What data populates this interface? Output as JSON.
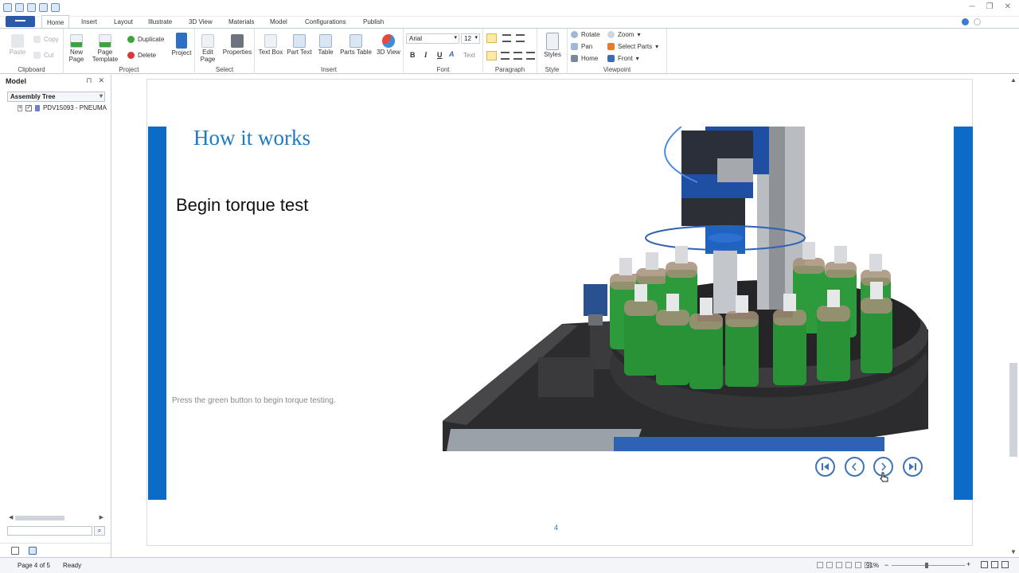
{
  "ribbon": {
    "tabs": [
      "Home",
      "Insert",
      "Layout",
      "Illustrate",
      "3D View",
      "Materials",
      "Model",
      "Configurations",
      "Publish"
    ],
    "clipboard": {
      "paste": "Paste",
      "copy": "Copy",
      "cut": "Cut",
      "label": "Clipboard"
    },
    "project": {
      "new_page_1": "New",
      "new_page_2": "Page",
      "page_template_1": "Page",
      "page_template_2": "Template",
      "duplicate": "Duplicate",
      "delete": "Delete",
      "project": "Project",
      "label": "Project"
    },
    "select": {
      "edit_page_1": "Edit",
      "edit_page_2": "Page",
      "properties": "Properties",
      "label": "Select"
    },
    "insert": {
      "text_box": "Text Box",
      "part_text": "Part Text",
      "table": "Table",
      "parts_table": "Parts Table",
      "view_3d": "3D View",
      "label": "Insert"
    },
    "font": {
      "name": "Arial",
      "size": "12",
      "bold": "B",
      "italic": "I",
      "underline": "U",
      "text": "Text",
      "label": "Font"
    },
    "paragraph": {
      "label": "Paragraph"
    },
    "style": {
      "styles": "Styles",
      "label": "Style"
    },
    "viewpoint": {
      "rotate": "Rotate",
      "pan": "Pan",
      "home": "Home",
      "zoom": "Zoom",
      "select_parts": "Select Parts",
      "front": "Front",
      "label": "Viewpoint"
    }
  },
  "left_pane": {
    "title": "Model",
    "combo": "Assembly Tree",
    "tree_item": "PDV15093 - PNEUMA"
  },
  "page": {
    "heading": "How it works",
    "subheading": "Begin torque test",
    "note": "Press the green button to begin torque testing.",
    "page_number": "4"
  },
  "statusbar": {
    "page": "Page 4 of 5",
    "status": "Ready",
    "zoom": "91%"
  },
  "colors": {
    "accent": "#0b6bc6",
    "heading": "#1f7ac4",
    "nav": "#3c75b7"
  }
}
